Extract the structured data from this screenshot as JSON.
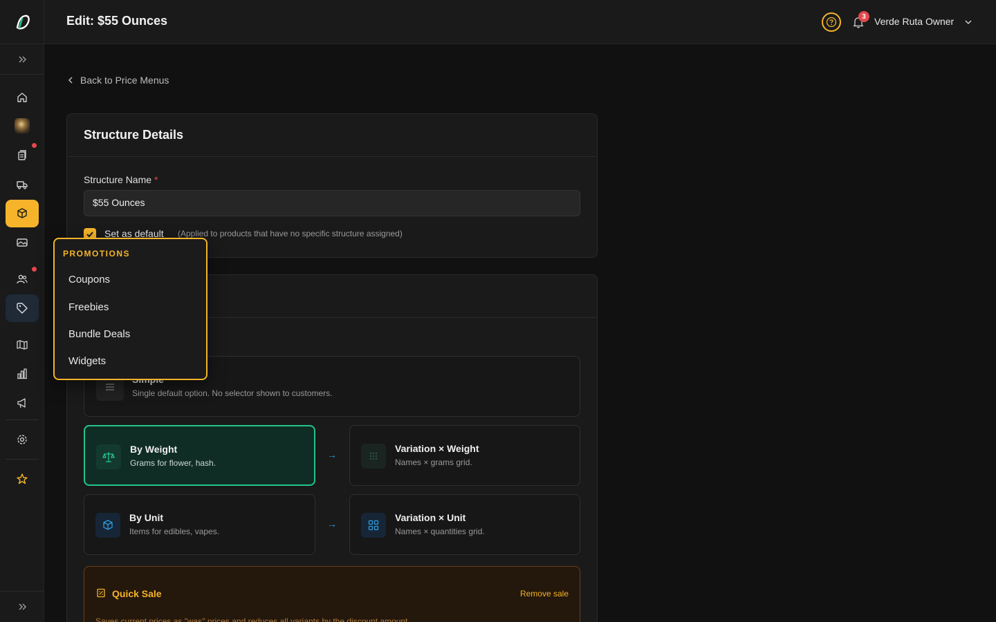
{
  "header": {
    "title": "Edit: $55 Ounces",
    "notification_count": "3",
    "user_name": "Verde Ruta Owner"
  },
  "colors": {
    "accent": "#f5b42a",
    "selected_green": "#22c58b",
    "badge_red": "#e5484d",
    "arrow_blue": "#2d9cdb"
  },
  "sidebar": {
    "items": [
      {
        "icon": "home-icon"
      },
      {
        "icon": "store-image"
      },
      {
        "icon": "orders-icon",
        "dot": true
      },
      {
        "icon": "delivery-truck-icon"
      },
      {
        "icon": "box-icon",
        "active": true
      },
      {
        "icon": "image-icon"
      },
      {
        "icon": "users-icon",
        "dot": true
      },
      {
        "icon": "tag-icon",
        "hover": true
      },
      {
        "icon": "book-icon"
      },
      {
        "icon": "chart-icon"
      },
      {
        "icon": "megaphone-icon"
      },
      {
        "icon": "gear-icon"
      },
      {
        "icon": "star-icon"
      }
    ]
  },
  "flyout": {
    "heading": "PROMOTIONS",
    "items": [
      "Coupons",
      "Freebies",
      "Bundle Deals",
      "Widgets"
    ]
  },
  "back_link": "Back to Price Menus",
  "structure_details": {
    "title": "Structure Details",
    "name_label": "Structure Name",
    "required_mark": "*",
    "name_value": "$55 Ounces",
    "default_label": "Set as default",
    "default_hint": "(Applied to products that have no specific structure assigned)",
    "default_checked": true
  },
  "options": {
    "simple": {
      "title": "Simple",
      "desc": "Single default option. No selector shown to customers."
    },
    "by_weight": {
      "title": "By Weight",
      "desc": "Grams for flower, hash.",
      "selected": true
    },
    "variation_weight": {
      "title": "Variation × Weight",
      "desc": "Names × grams grid."
    },
    "by_unit": {
      "title": "By Unit",
      "desc": "Items for edibles, vapes."
    },
    "variation_unit": {
      "title": "Variation × Unit",
      "desc": "Names × quantities grid."
    },
    "arrow": "→"
  },
  "quick_sale": {
    "title": "Quick Sale",
    "remove_label": "Remove sale",
    "desc": "Saves current prices as \"was\" prices and reduces all variants by the discount amount."
  }
}
